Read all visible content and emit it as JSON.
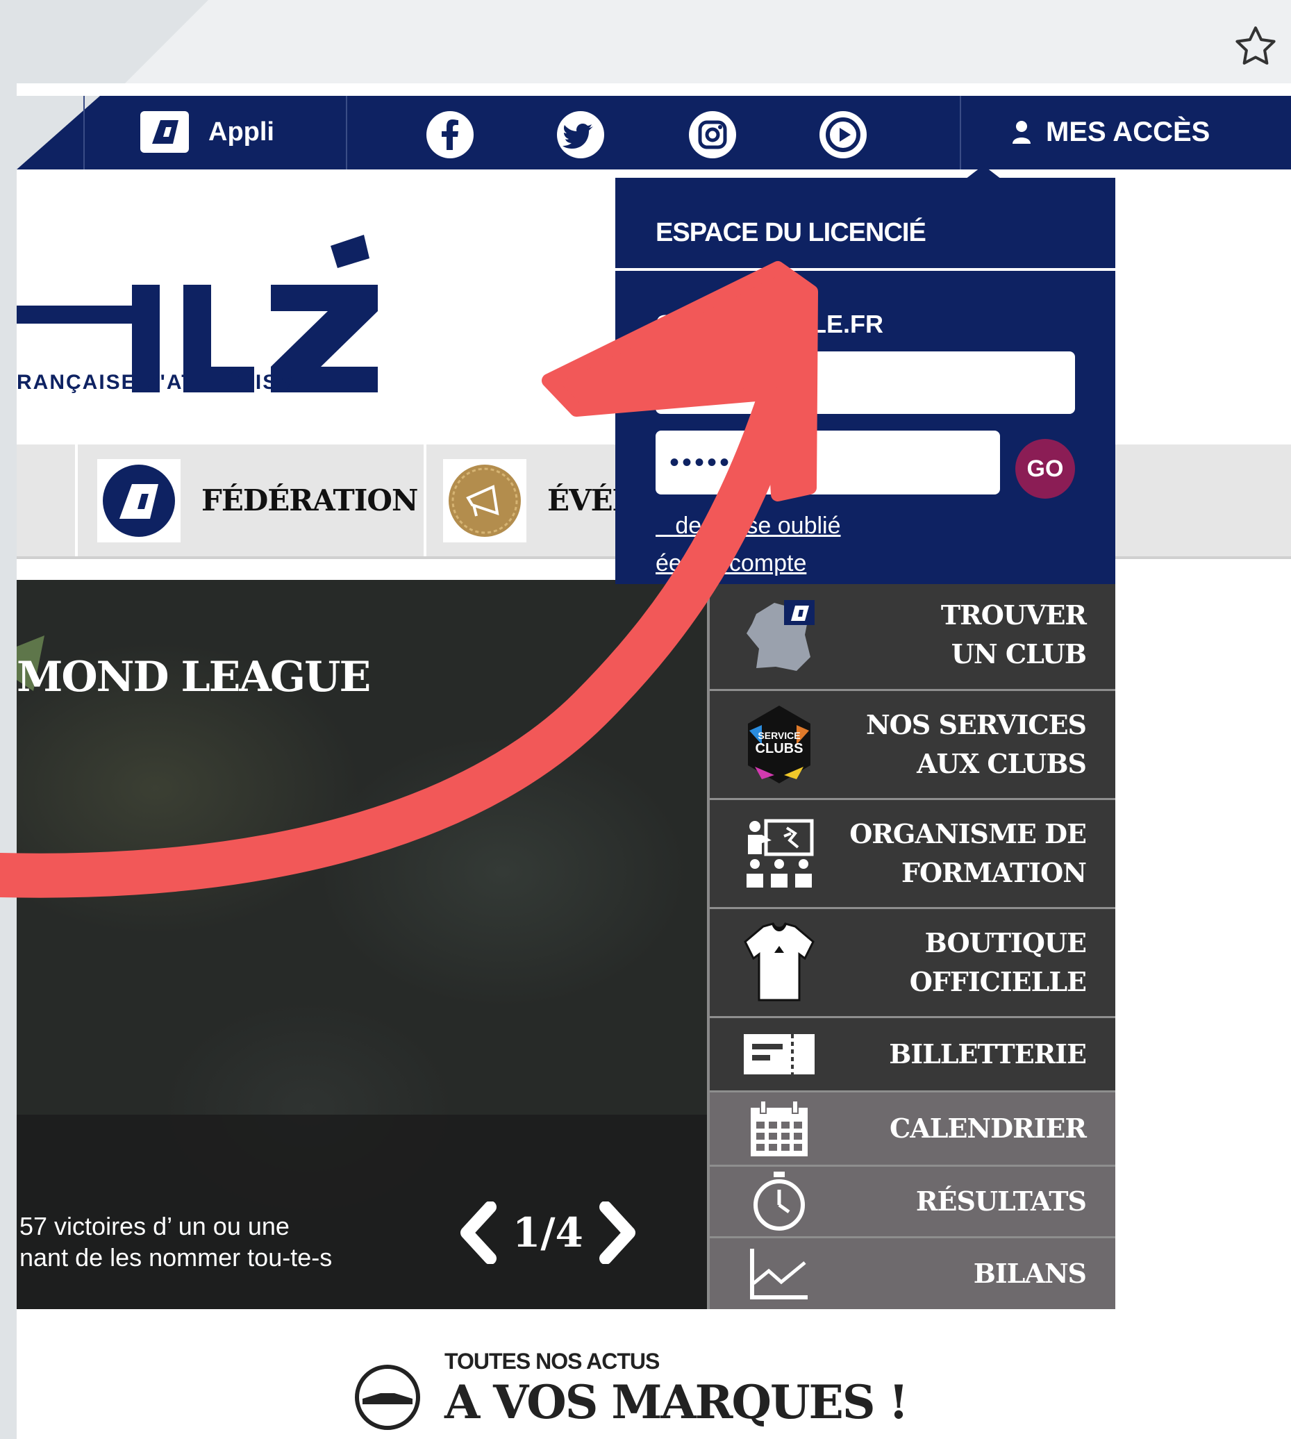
{
  "topbar": {
    "appli_label": "Appli",
    "social": [
      "facebook-icon",
      "twitter-icon",
      "instagram-icon",
      "youtube-icon"
    ],
    "access_label": "MES ACCÈS"
  },
  "logo": {
    "word": "HLÉ",
    "subtitle": "RANÇAISE D'ATHLÉTISME"
  },
  "nav": [
    {
      "label": "FÉDÉRATION"
    },
    {
      "label": "ÉVÉN"
    }
  ],
  "dropdown": {
    "title": "ESPACE DU LICENCIÉ",
    "subtitle": "CO                ILE.FR",
    "email_placeholder": "Ema",
    "password_value": "•••••••••••",
    "go_label": "GO",
    "forgot_label": "   de passe oublié",
    "create_label": "éer un compte"
  },
  "hero": {
    "title": "MOND LEAGUE",
    "subtitle_line1": "57 victoires d’ un ou une",
    "subtitle_line2": "nant de les nommer tou-te-s",
    "pager": "1/4"
  },
  "side_menu": [
    {
      "label": "TROUVER\nUN CLUB",
      "icon": "france-map-icon"
    },
    {
      "label": "NOS SERVICES\nAUX CLUBS",
      "icon": "service-clubs-icon"
    },
    {
      "label": "ORGANISME DE\nFORMATION",
      "icon": "training-icon"
    },
    {
      "label": "BOUTIQUE\nOFFICIELLE",
      "icon": "jersey-icon"
    },
    {
      "label": "BILLETTERIE",
      "icon": "ticket-icon"
    },
    {
      "label": "CALENDRIER",
      "icon": "calendar-icon"
    },
    {
      "label": "RÉSULTATS",
      "icon": "stopwatch-icon"
    },
    {
      "label": "BILANS",
      "icon": "line-chart-icon"
    }
  ],
  "actus": {
    "small": "TOUTES NOS ACTUS",
    "big": "A VOS MARQUES !"
  },
  "colors": {
    "navy": "#0e2262",
    "go": "#8b1d55",
    "arrow": "#f25858",
    "side_dark": "#383838",
    "side_light": "#6e6a6d"
  }
}
